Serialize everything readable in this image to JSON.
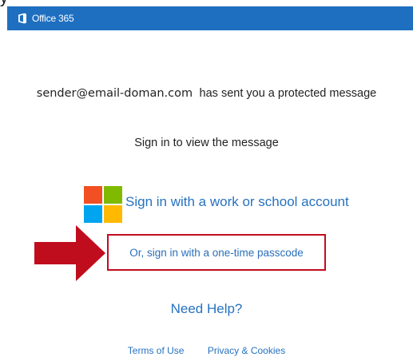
{
  "top_partial_text": "y",
  "header": {
    "brand_name": "Office 365",
    "brand_color": "#1e6fc0"
  },
  "message": {
    "sender_email": "sender@email-doman.com",
    "sent_text": "has sent you a protected message",
    "instruction": "Sign in to view the message"
  },
  "signin": {
    "work_account_label": "Sign in with a work or school account",
    "logo_icon": "microsoft-logo-icon",
    "passcode_label": "Or, sign in with a one-time passcode",
    "highlight_color": "#c00d1e",
    "link_color": "#2672c0"
  },
  "help": {
    "label": "Need Help?"
  },
  "footer": {
    "terms_label": "Terms of Use",
    "privacy_label": "Privacy & Cookies"
  }
}
